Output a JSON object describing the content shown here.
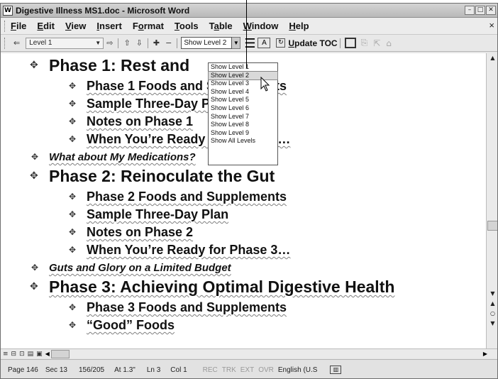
{
  "window": {
    "title": "Digestive Illness MS1.doc - Microsoft Word",
    "minimize": "–",
    "maximize": "□",
    "close": "✕"
  },
  "menu": {
    "items": [
      {
        "ul": "F",
        "rest": "ile"
      },
      {
        "ul": "E",
        "rest": "dit"
      },
      {
        "ul": "V",
        "rest": "iew"
      },
      {
        "ul": "I",
        "rest": "nsert"
      },
      {
        "pre": "F",
        "ul": "o",
        "rest": "rmat"
      },
      {
        "ul": "T",
        "rest": "ools"
      },
      {
        "pre": "T",
        "ul": "a",
        "rest": "ble"
      },
      {
        "ul": "W",
        "rest": "indow"
      },
      {
        "ul": "H",
        "rest": "elp"
      }
    ],
    "close_doc": "×"
  },
  "toolbar": {
    "level_select": "Level 1",
    "show_level": "Show Level 2",
    "update_toc_ul": "U",
    "update_toc_rest": "pdate TOC",
    "icons": {
      "promote_heading": "⇐",
      "promote": "⇦",
      "demote": "⇨",
      "move_up": "⇧",
      "move_down": "⇩",
      "expand": "✚",
      "collapse": "−",
      "show_first_line": "☰",
      "show_formatting": "A",
      "update_toc_icon": "↻",
      "toc_box": "",
      "goto_toc": "⇱",
      "master_doc": "⎘",
      "subdoc": "⌂"
    }
  },
  "dropdown": {
    "options": [
      "Show Level 1",
      "Show Level 2",
      "Show Level 3",
      "Show Level 4",
      "Show Level 5",
      "Show Level 6",
      "Show Level 7",
      "Show Level 8",
      "Show Level 9",
      "Show All Levels"
    ],
    "selected": "Show Level 2"
  },
  "document": {
    "rows": [
      {
        "text": "Phase 1: Rest and",
        "level": "lvl1"
      },
      {
        "text": "Phase 1 Foods and Supplements",
        "level": "lvl2"
      },
      {
        "text": "Sample Three-Day Plan",
        "level": "lvl2"
      },
      {
        "text": "Notes on Phase 1",
        "level": "lvl2"
      },
      {
        "text": "When You’re Ready for Phase 2…",
        "level": "lvl2"
      },
      {
        "text": "What about My Medications?",
        "level": "lvlit"
      },
      {
        "text": "Phase 2: Reinoculate the Gut",
        "level": "lvl1"
      },
      {
        "text": "Phase 2 Foods and Supplements",
        "level": "lvl2"
      },
      {
        "text": "Sample Three-Day Plan",
        "level": "lvl2"
      },
      {
        "text": "Notes on Phase 2",
        "level": "lvl2"
      },
      {
        "text": "When You’re Ready for Phase 3…",
        "level": "lvl2"
      },
      {
        "text": "Guts and Glory on a Limited Budget",
        "level": "lvlit"
      },
      {
        "text": "Phase 3: Achieving Optimal Digestive Health",
        "level": "lvl1"
      },
      {
        "text": "Phase 3 Foods and Supplements",
        "level": "lvl2"
      },
      {
        "text": "“Good” Foods",
        "level": "lvl2"
      }
    ],
    "bullet": "✥"
  },
  "scroll": {
    "up": "▲",
    "down": "▼",
    "prev": "▲",
    "select": "○",
    "next": "▼",
    "left": "◀",
    "right": "▶"
  },
  "views": [
    "≡",
    "⊟",
    "⊡",
    "▤",
    "▣"
  ],
  "status": {
    "page": "Page 146",
    "sec": "Sec 13",
    "pages": "156/205",
    "at": "At 1.3\"",
    "ln": "Ln 3",
    "col": "Col 1",
    "rec": "REC",
    "trk": "TRK",
    "ext": "EXT",
    "ovr": "OVR",
    "language": "English (U.S",
    "book_icon": "▥"
  }
}
